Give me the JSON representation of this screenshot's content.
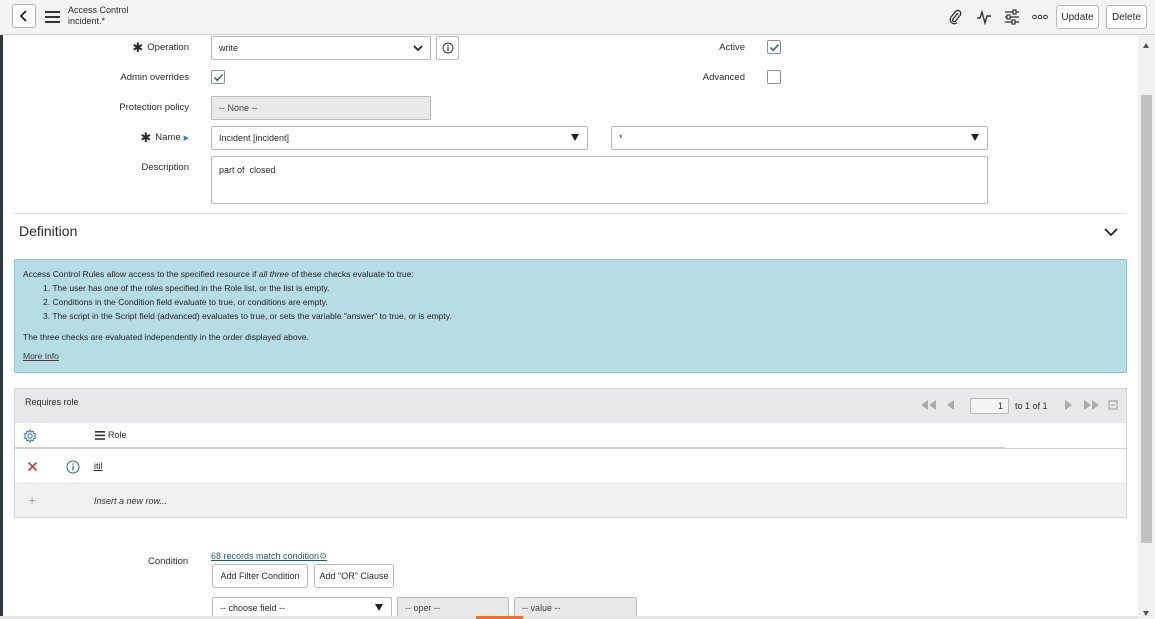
{
  "header": {
    "title_line1": "Access Control",
    "title_line2": "incident.*",
    "update_label": "Update",
    "delete_label": "Delete",
    "icons": [
      "back-arrow-icon",
      "menu-icon",
      "paperclip-icon",
      "activity-icon",
      "settings-sliders-icon",
      "more-icon"
    ]
  },
  "form": {
    "operation": {
      "label": "Operation",
      "value": "write"
    },
    "active": {
      "label": "Active",
      "checked": true
    },
    "admin_overrides": {
      "label": "Admin overrides",
      "checked": true
    },
    "advanced": {
      "label": "Advanced",
      "checked": false
    },
    "protection_policy": {
      "label": "Protection policy",
      "value": "-- None --"
    },
    "name": {
      "label": "Name",
      "table_value": "Incident [incident]",
      "field_value": "*"
    },
    "description": {
      "label": "Description",
      "value": "part of  closed"
    }
  },
  "definition": {
    "title": "Definition",
    "info_intro_pre": "Access Control Rules allow access to the specified resource if ",
    "info_intro_em": "all three",
    "info_intro_post": " of these checks evaluate to true:",
    "items": [
      {
        "num": "1.",
        "pre": "The user has one of the roles specified in the ",
        "bold": "Role",
        "post": " list, or the list is empty."
      },
      {
        "num": "2.",
        "pre": "Conditions in the ",
        "bold": "Condition",
        "post": " field evaluate to true, or conditions are empty."
      },
      {
        "num": "3.",
        "pre": "The script in the ",
        "bold": "Script",
        "post": " field (advanced) evaluates to true, or sets the variable \"answer\" to true, or is empty."
      }
    ],
    "closing": "The three checks are evaluated independently in the order displayed above.",
    "more_info": "More Info"
  },
  "requires_role": {
    "title": "Requires role",
    "page_value": "1",
    "page_of": "to 1 of 1",
    "column": "Role",
    "rows": [
      {
        "role": "itil"
      }
    ],
    "insert_placeholder": "Insert a new row..."
  },
  "condition": {
    "label": "Condition",
    "match_text": "68 records match condition",
    "add_filter_label": "Add Filter Condition",
    "add_or_label": "Add \"OR\" Clause",
    "field_placeholder": "-- choose field --",
    "oper_placeholder": "-- oper --",
    "value_placeholder": "-- value --"
  },
  "colors": {
    "info_bg": "#b6dde6",
    "accent": "#e8732c",
    "delete_x": "#e53935"
  }
}
